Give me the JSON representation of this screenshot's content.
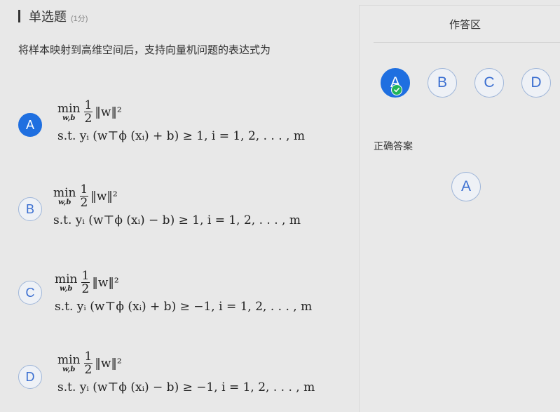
{
  "question": {
    "type_label": "单选题",
    "score_label": "(1分)",
    "text": "将样本映射到高维空间后，支持向量机问题的表达式为"
  },
  "formula": {
    "min": "min",
    "min_sub": "w,b",
    "frac_num": "1",
    "frac_den": "2",
    "norm": "‖w‖²"
  },
  "options": [
    {
      "letter": "A",
      "selected": true,
      "constraint": "s.t. yᵢ (w⊤ϕ (xᵢ) + b) ≥ 1, i = 1, 2, . . . , m"
    },
    {
      "letter": "B",
      "selected": false,
      "constraint": "s.t. yᵢ (w⊤ϕ (xᵢ) − b) ≥ 1, i = 1, 2, . . . , m"
    },
    {
      "letter": "C",
      "selected": false,
      "constraint": "s.t. yᵢ (w⊤ϕ (xᵢ) + b) ≥ −1, i = 1, 2, . . . , m"
    },
    {
      "letter": "D",
      "selected": false,
      "constraint": "s.t. yᵢ (w⊤ϕ (xᵢ) − b) ≥ −1, i = 1, 2, . . . , m"
    }
  ],
  "answer_panel": {
    "title": "作答区",
    "buttons": [
      "A",
      "B",
      "C",
      "D"
    ],
    "selected": "A",
    "correct_label": "正确答案",
    "correct_answer": "A"
  },
  "colors": {
    "selected_blue": "#1f6fe0",
    "check_green": "#22b55a",
    "option_text_blue": "#3b6fd1"
  },
  "icons": {
    "check": "check-circle-icon"
  }
}
